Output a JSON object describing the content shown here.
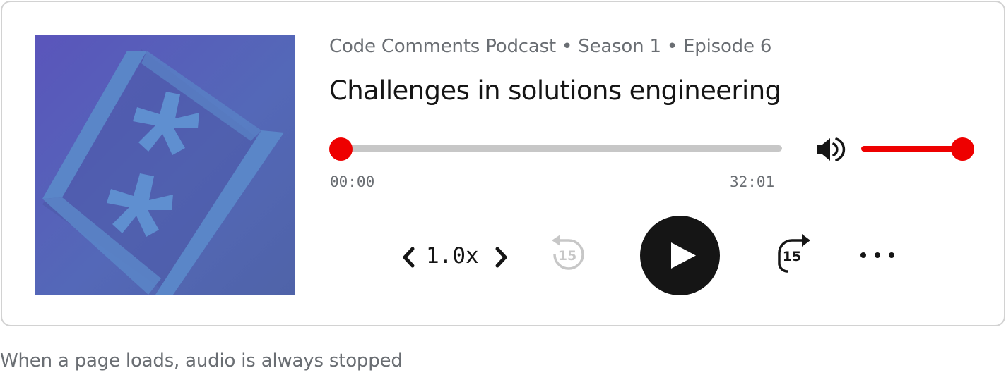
{
  "player": {
    "episode_meta": "Code Comments Podcast • Season 1 • Episode 6",
    "episode_title": "Challenges in solutions engineering",
    "cover_icon": "podcast-cover-asterisk-art",
    "progress": {
      "current_time": "00:00",
      "total_time": "32:01",
      "fraction": 0.0
    },
    "volume": {
      "level": 1.0,
      "icon": "volume-icon"
    },
    "speed": {
      "label": "1.0x",
      "decrease_icon": "chevron-left-icon",
      "increase_icon": "chevron-right-icon"
    },
    "rewind": {
      "seconds_label": "15",
      "icon": "rewind-icon",
      "disabled": true
    },
    "forward": {
      "seconds_label": "15",
      "icon": "forward-icon"
    },
    "play": {
      "icon": "play-icon"
    },
    "more": {
      "icon": "more-horizontal-icon"
    },
    "colors": {
      "accent": "#ee0000",
      "track": "#c7c7c7",
      "text": "#151515",
      "muted_text": "#6a6e73",
      "border": "#d2d2d2"
    }
  },
  "caption": "When a page loads, audio is always stopped"
}
